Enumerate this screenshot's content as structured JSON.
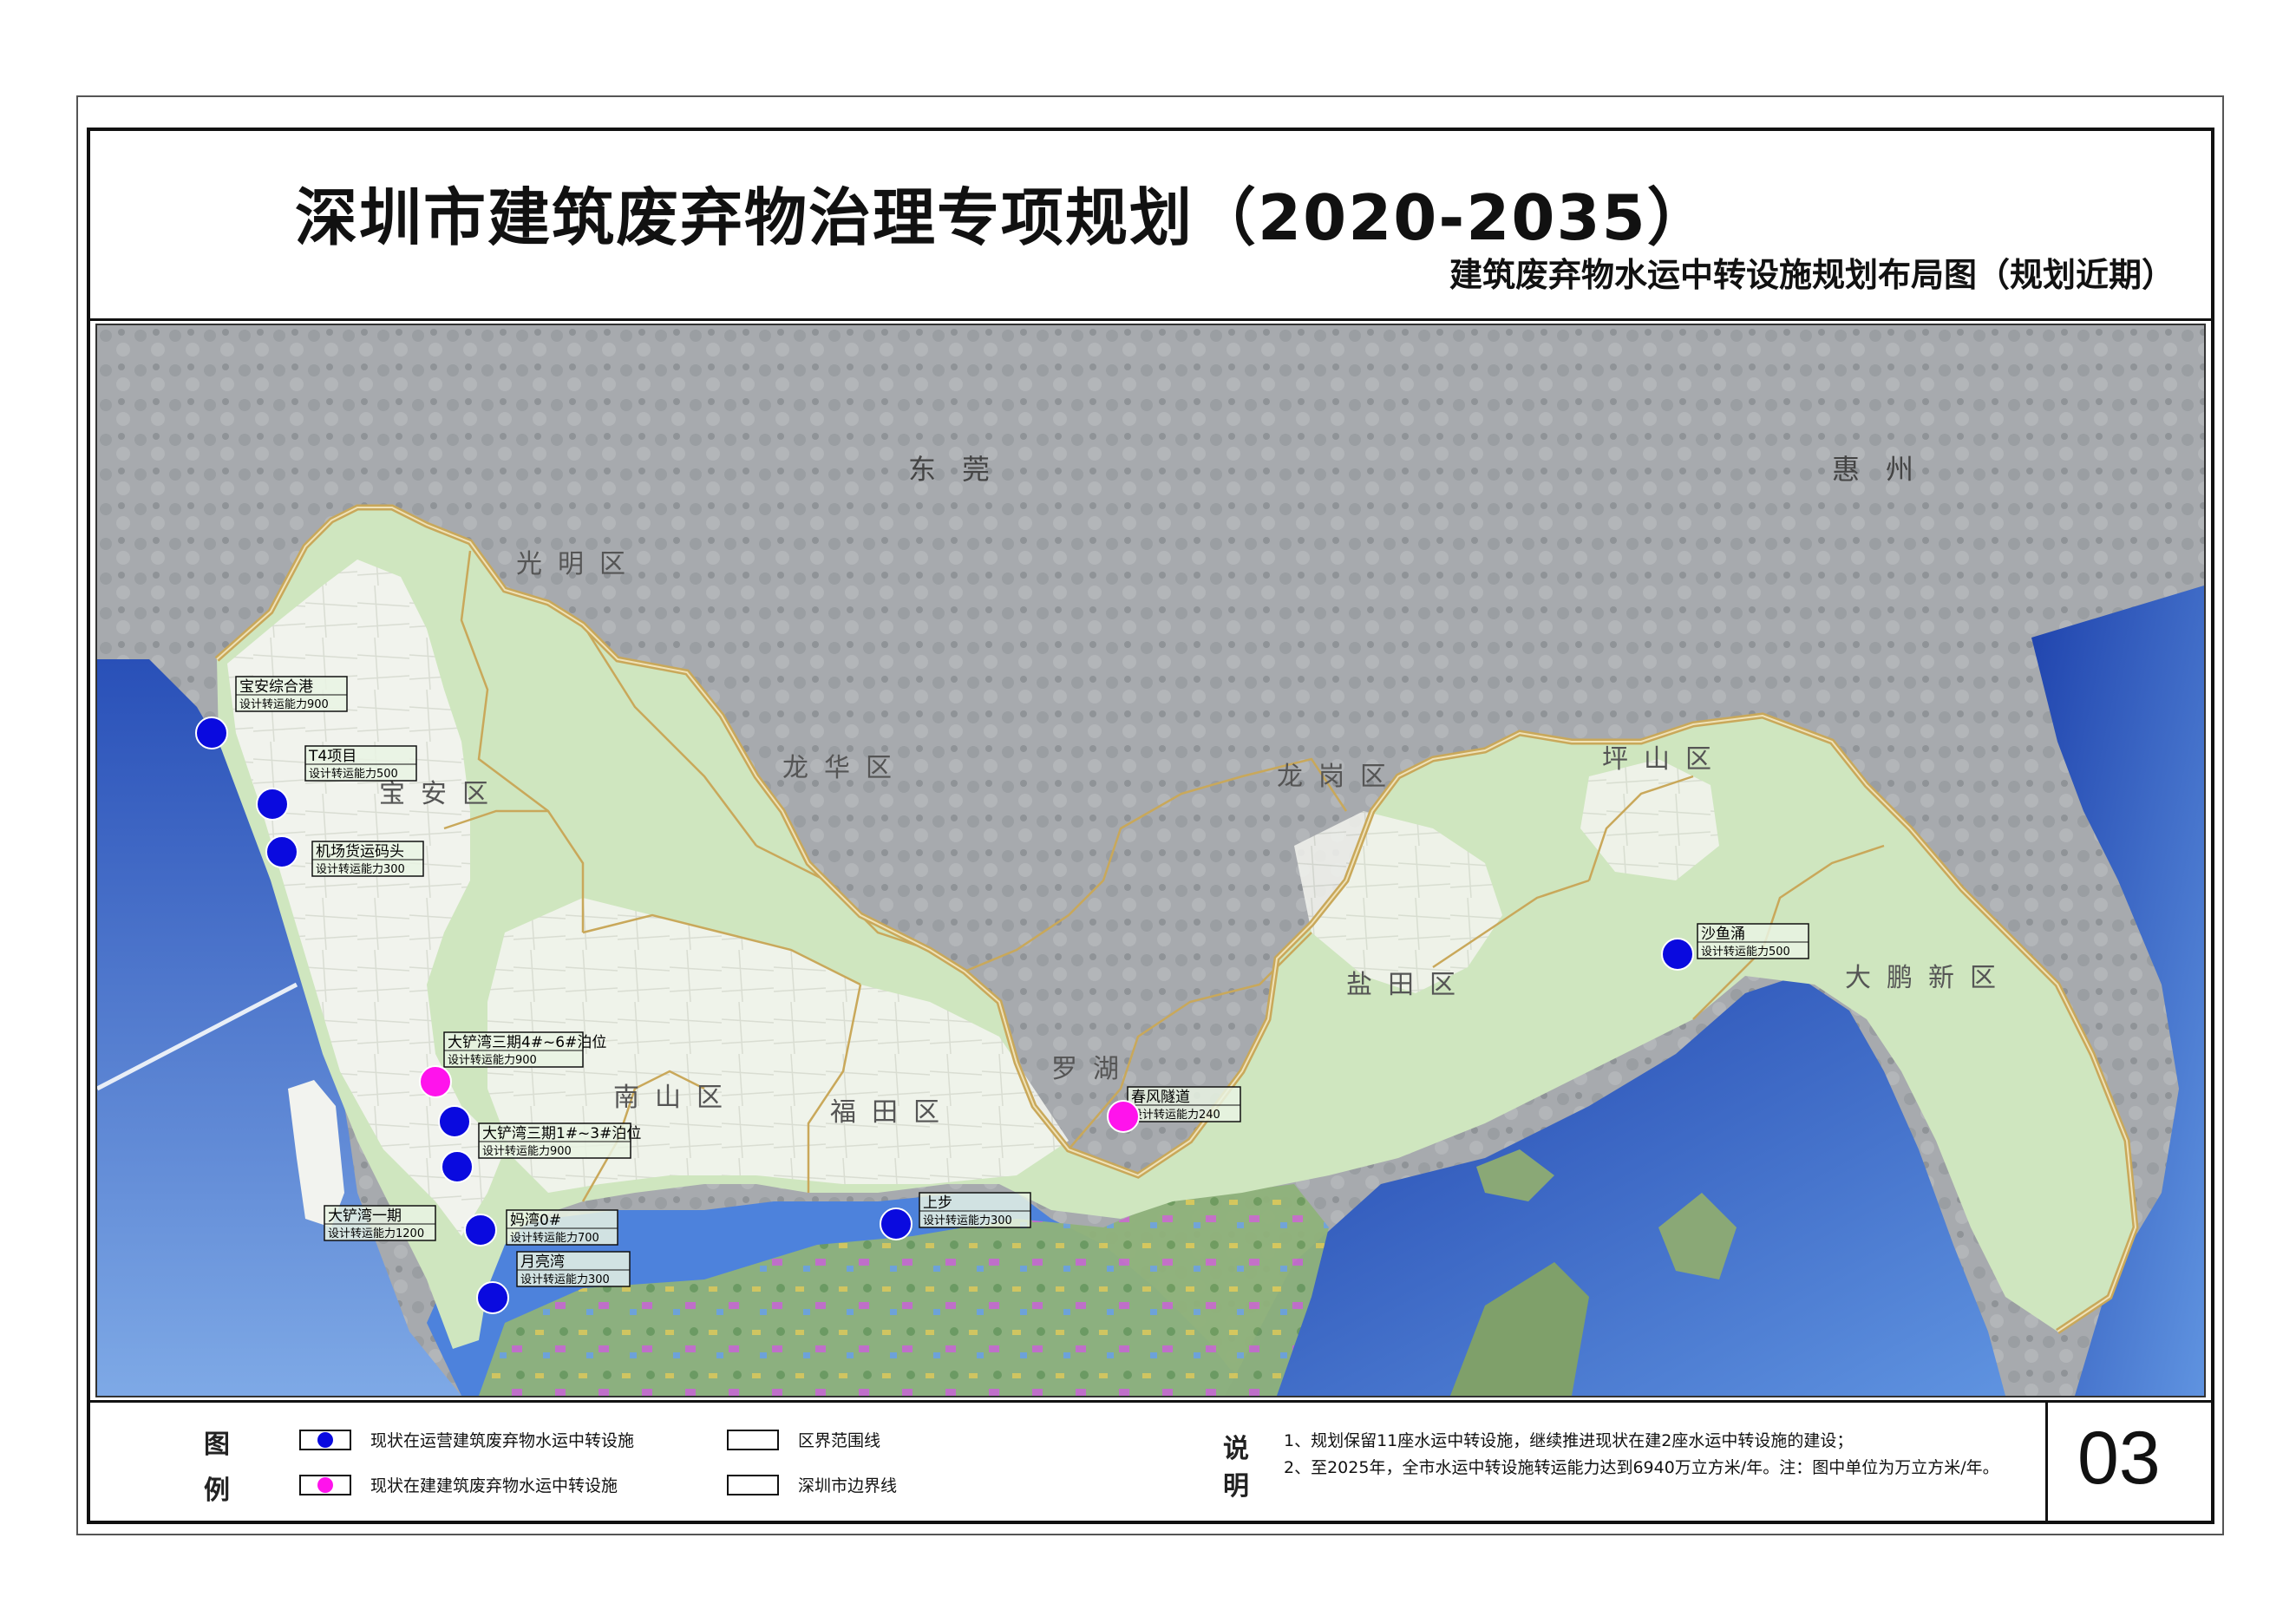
{
  "header": {
    "title": "深圳市建筑废弃物治理专项规划（2020-2035）",
    "subtitle": "建筑废弃物水运中转设施规划布局图（规划近期）"
  },
  "map": {
    "neighbor_labels": [
      "东莞",
      "惠州"
    ],
    "district_labels": [
      "光明区",
      "宝安区",
      "龙华区",
      "龙岗区",
      "坪山区",
      "南山区",
      "福田区",
      "罗湖",
      "盐田区",
      "大鹏新区"
    ],
    "colors": {
      "operating": "#0a0adf",
      "construction": "#ff13ec",
      "boundary": "#c9a85a",
      "land": "#cfe6bf",
      "urban": "#f6f7f3",
      "sea": "#3f72d6",
      "gray_terrain": "#a3a6aa"
    },
    "facilities": [
      {
        "name": "宝安综合港",
        "capacity": "设计转运能力900",
        "status": "operating"
      },
      {
        "name": "T4项目",
        "capacity": "设计转运能力500",
        "status": "operating"
      },
      {
        "name": "机场货运码头",
        "capacity": "设计转运能力300",
        "status": "operating"
      },
      {
        "name": "大铲湾三期4#~6#泊位",
        "capacity": "设计转运能力900",
        "status": "construction"
      },
      {
        "name": "大铲湾三期1#~3#泊位",
        "capacity": "设计转运能力900",
        "status": "operating"
      },
      {
        "name": "大铲湾一期",
        "capacity": "设计转运能力1200",
        "status": "operating"
      },
      {
        "name": "妈湾0#",
        "capacity": "设计转运能力700",
        "status": "operating"
      },
      {
        "name": "月亮湾",
        "capacity": "设计转运能力300",
        "status": "operating"
      },
      {
        "name": "上步",
        "capacity": "设计转运能力300",
        "status": "operating"
      },
      {
        "name": "春风隧道",
        "capacity": "设计转运能力240",
        "status": "construction"
      },
      {
        "name": "沙鱼涌",
        "capacity": "设计转运能力500",
        "status": "operating"
      }
    ]
  },
  "legend": {
    "label_top": "图",
    "label_bottom": "例",
    "items": [
      {
        "label": "现状在运营建筑废弃物水运中转设施",
        "icon": "blue-dot-icon"
      },
      {
        "label": "现状在建建筑废弃物水运中转设施",
        "icon": "magenta-dot-icon"
      },
      {
        "label": "区界范围线",
        "icon": "district-line-icon"
      },
      {
        "label": "深圳市边界线",
        "icon": "city-boundary-icon"
      }
    ]
  },
  "notes": {
    "label_top": "说",
    "label_bottom": "明",
    "lines": [
      "1、规划保留11座水运中转设施，继续推进现状在建2座水运中转设施的建设；",
      "2、至2025年，全市水运中转设施转运能力达到6940万立方米/年。注：图中单位为万立方米/年。"
    ]
  },
  "sheet_number": "03"
}
